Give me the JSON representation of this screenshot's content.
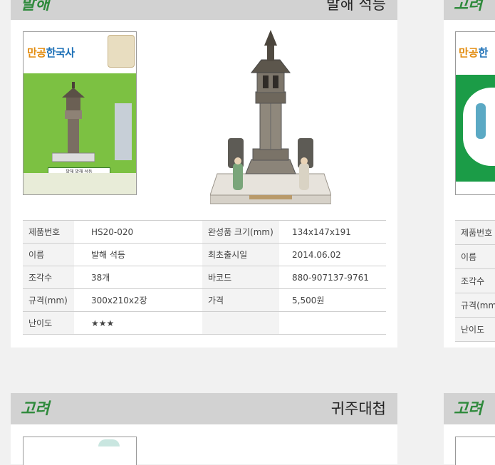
{
  "cards": [
    {
      "era": "발해",
      "title": "발해 석등",
      "book": {
        "series_part1": "만공",
        "series_part2": "한국사",
        "label": "발해    발해 석등"
      },
      "specs": {
        "rows": [
          {
            "label1": "제품번호",
            "value1": "HS20-020",
            "label2": "완성품 크기(mm)",
            "value2": "134x147x191"
          },
          {
            "label1": "이름",
            "value1": "발해 석등",
            "label2": "최초출시일",
            "value2": "2014.06.02"
          },
          {
            "label1": "조각수",
            "value1": "38개",
            "label2": "바코드",
            "value2": "880-907137-9761"
          },
          {
            "label1": "규격(mm)",
            "value1": "300x210x2장",
            "label2": "가격",
            "value2": "5,500원"
          },
          {
            "label1": "난이도",
            "value1": "★★★",
            "label2": "",
            "value2": ""
          }
        ]
      }
    },
    {
      "era": "고려",
      "book": {
        "series_part1": "만공",
        "series_part2": "한"
      },
      "labels": [
        "제품번호",
        "이름",
        "조각수",
        "규격(mm",
        "난이도"
      ]
    },
    {
      "era": "고려",
      "title": "귀주대첩"
    },
    {
      "era": "고려"
    }
  ],
  "colors": {
    "era_green": "#2f8a3c",
    "header_gray": "#d2d2d2",
    "page_bg": "#f1f1f1"
  }
}
